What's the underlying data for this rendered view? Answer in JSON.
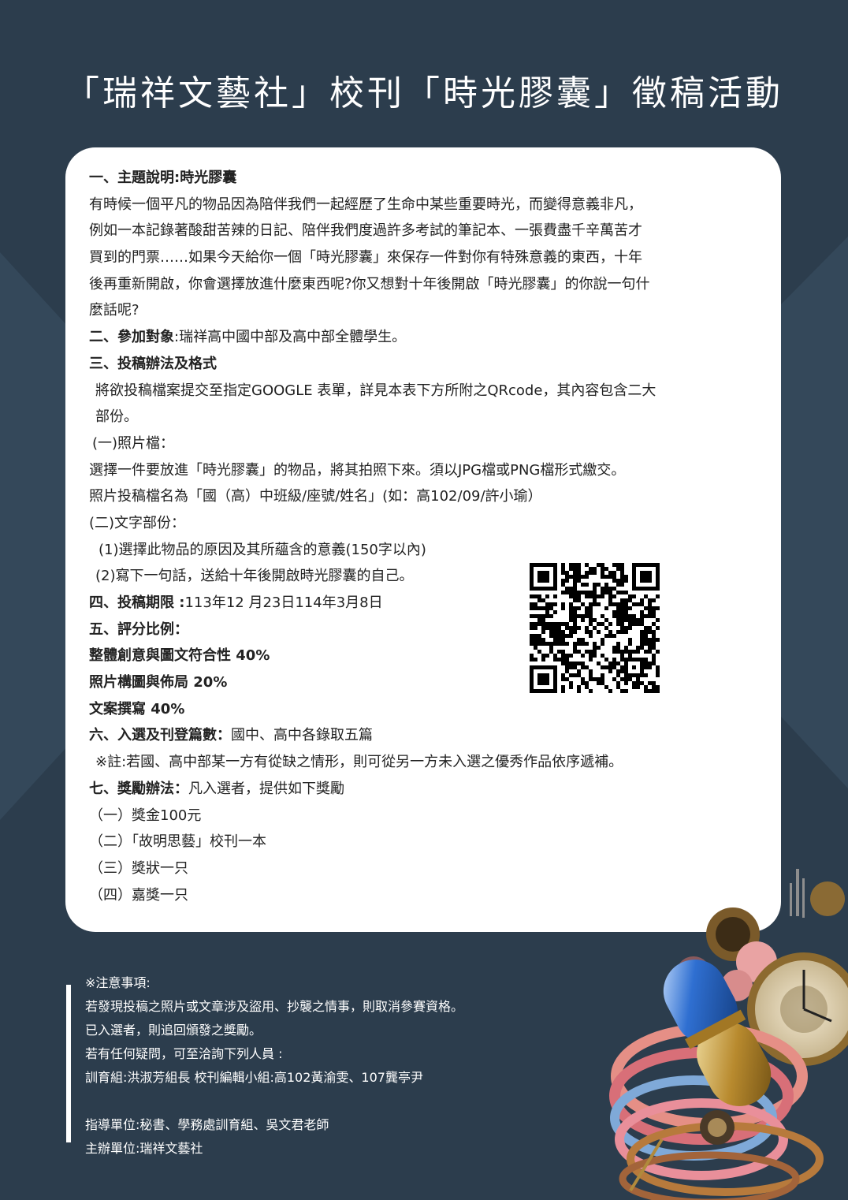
{
  "colors": {
    "background": "#2c3d4d",
    "card": "#ffffff",
    "text": "#222222",
    "notes_text": "#ffffff"
  },
  "title": "「瑞祥文藝社」校刊「時光膠囊」徵稿活動",
  "sections": {
    "s1_heading": "一、主題說明:時光膠囊",
    "s1_p1": "有時候一個平凡的物品因為陪伴我們一起經歷了生命中某些重要時光，而變得意義非凡，",
    "s1_p2": "例如一本記錄著酸甜苦辣的日記、陪伴我們度過許多考試的筆記本、一張費盡千辛萬苦才",
    "s1_p3": "買到的門票……如果今天給你一個「時光膠囊」來保存一件對你有特殊意義的東西，十年",
    "s1_p4": "後再重新開啟，你會選擇放進什麼東西呢?你又想對十年後開啟「時光膠囊」的你說一句什",
    "s1_p5": "麼話呢?",
    "s2_label": "二、參加對象",
    "s2_text": ":瑞祥高中國中部及高中部全體學生。",
    "s3_heading": "三、投稿辦法及格式",
    "s3_p1": "將欲投稿檔案提交至指定GOOGLE 表單，詳見本表下方所附之QRcode，其內容包含二大",
    "s3_p2": "部份。",
    "s3_sub1": "(一)照片檔：",
    "s3_sub1_p1": "選擇一件要放進「時光膠囊」的物品，將其拍照下來。須以JPG檔或PNG檔形式繳交。",
    "s3_sub1_p2": "照片投稿檔名為「國（高）中班級/座號/姓名」(如：高102/09/許小瑜）",
    "s3_sub2": "(二)文字部份：",
    "s3_sub2_i1": "(1)選擇此物品的原因及其所蘊含的意義(150字以內)",
    "s3_sub2_i2": "(2)寫下一句話，送給十年後開啟時光膠囊的自己。",
    "s4_label": "四、投稿期限 :",
    "s4_text": "113年12 月23日114年3月8日",
    "s5_heading": "五、評分比例：",
    "s5_i1": "整體創意與圖文符合性 40%",
    "s5_i2": "照片構圖與佈局 20%",
    "s5_i3": "文案撰寫 40%",
    "s6_label": "六、入選及刊登篇數：",
    "s6_text": "國中、高中各錄取五篇",
    "s6_note": "※註:若國、高中部某一方有從缺之情形，則可從另一方未入選之優秀作品依序遞補。",
    "s7_label": "七、獎勵辦法：",
    "s7_text": "凡入選者，提供如下獎勵",
    "s7_i1": "（一）獎金100元",
    "s7_i2": "（二）「故明思藝」校刊一本",
    "s7_i3": "（三）獎狀一只",
    "s7_i4": "（四）嘉獎一只"
  },
  "notes": {
    "n1": "※注意事項:",
    "n2": "若發現投稿之照片或文章涉及盜用、抄襲之情事，則取消參賽資格。",
    "n3": "已入選者，則追回頒發之獎勵。",
    "n4": "若有任何疑問，可至洽詢下列人員 :",
    "n5": " 訓育組:洪淑芳組長 校刊編輯小組:高102黃渝雯、107龔亭尹",
    "n6": "指導單位:秘書、學務處訓育組、吳文君老師",
    "n7": "主辦單位:瑞祥文藝社"
  },
  "icons": {
    "qr": "qr-code",
    "art": "time-capsule-illustration"
  }
}
